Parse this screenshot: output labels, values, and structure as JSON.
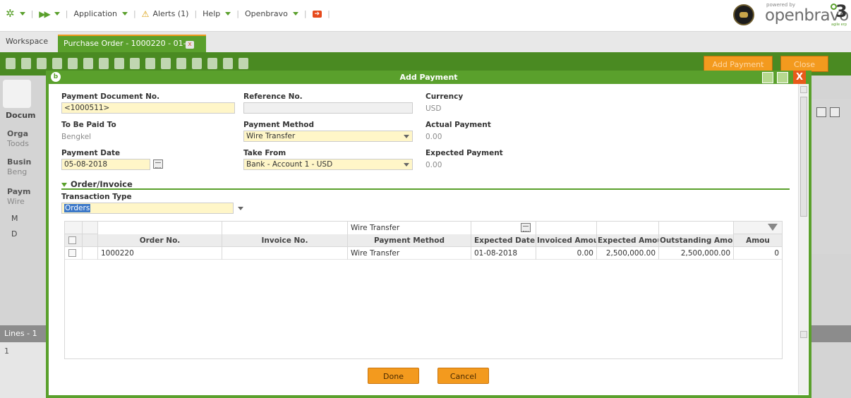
{
  "topnav": {
    "application_label": "Application",
    "alerts_label": "Alerts (1)",
    "help_label": "Help",
    "openbravo_label": "Openbravo",
    "brand_powered": "powered by",
    "brand_word": "openbravo",
    "brand_version": "3",
    "brand_tagline": "agile erp"
  },
  "tabs": {
    "workspace": "Workspace",
    "active": "Purchase Order - 1000220 - 01-...",
    "close_glyph": "x"
  },
  "toolbar": {
    "add_payment_label": "Add Payment",
    "close_label": "Close"
  },
  "modal": {
    "title": "Add Payment",
    "logo_glyph": "b",
    "close_glyph": "X",
    "fields": {
      "payment_document_no": {
        "label": "Payment Document No.",
        "value": "<1000511>"
      },
      "reference_no": {
        "label": "Reference No.",
        "value": ""
      },
      "currency": {
        "label": "Currency",
        "value": "USD"
      },
      "to_be_paid_to": {
        "label": "To Be Paid To",
        "value": "Bengkel"
      },
      "payment_method": {
        "label": "Payment Method",
        "value": "Wire Transfer"
      },
      "actual_payment": {
        "label": "Actual Payment",
        "value": "0.00"
      },
      "payment_date": {
        "label": "Payment Date",
        "value": "05-08-2018"
      },
      "take_from": {
        "label": "Take From",
        "value": "Bank - Account 1 - USD"
      },
      "expected_payment": {
        "label": "Expected Payment",
        "value": "0.00"
      }
    },
    "section_title": "Order/Invoice",
    "transaction_type": {
      "label": "Transaction Type",
      "value": "Orders"
    },
    "grid": {
      "filter_payment_method": "Wire Transfer",
      "columns": [
        "Order No.",
        "Invoice No.",
        "Payment Method",
        "Expected Date",
        "Invoiced Amount",
        "Expected Amount",
        "Outstanding Amount",
        "Amou"
      ],
      "rows": [
        {
          "order_no": "1000220",
          "invoice_no": "",
          "payment_method": "Wire Transfer",
          "expected_date": "01-08-2018",
          "invoiced_amount": "0.00",
          "expected_amount": "2,500,000.00",
          "outstanding_amount": "2,500,000.00",
          "amount": "0"
        }
      ]
    },
    "done_label": "Done",
    "cancel_label": "Cancel"
  },
  "background": {
    "left_labels": [
      "Docum",
      "Orga",
      "Toods",
      "Busin",
      "Beng",
      "Paym",
      "Wire",
      "M",
      "D",
      "Lines - 1",
      "1"
    ]
  }
}
